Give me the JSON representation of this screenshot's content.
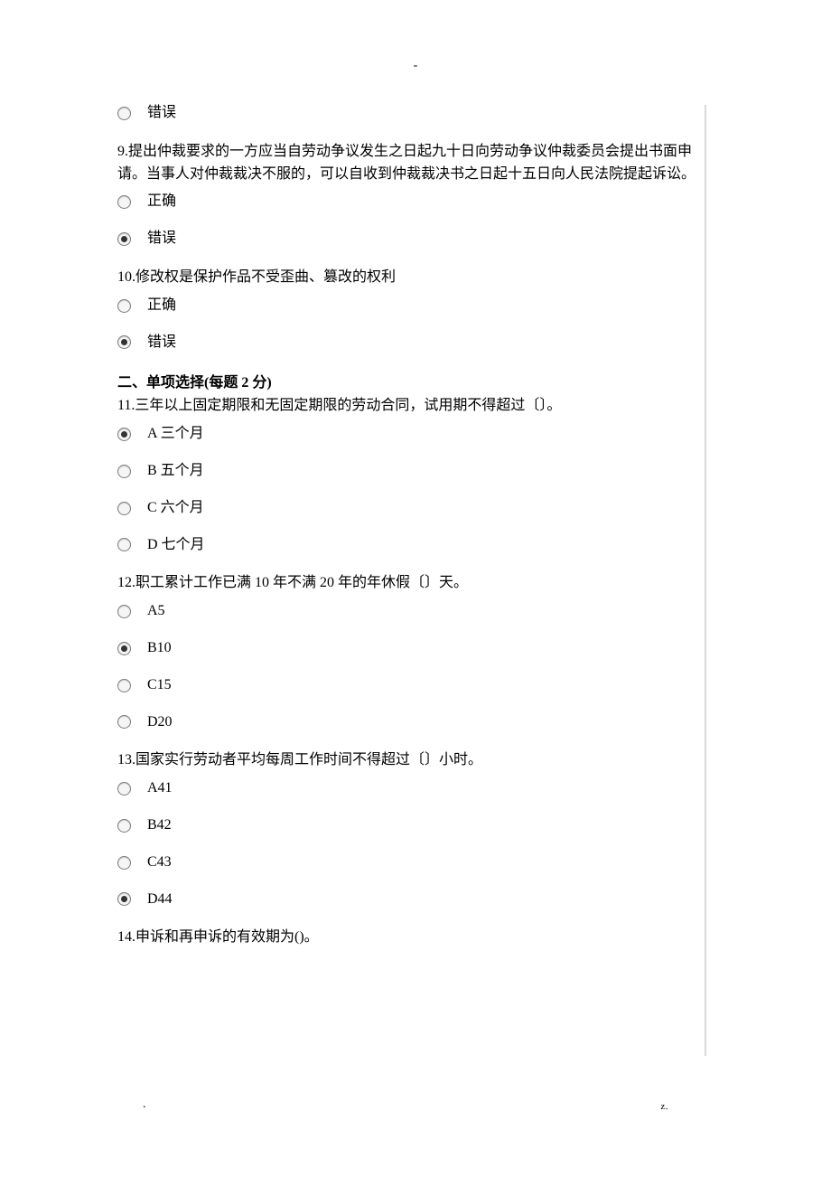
{
  "page": {
    "top_mark": "-",
    "footer_dot": ".",
    "footer_z": "z."
  },
  "q8": {
    "opt_false": "错误"
  },
  "q9": {
    "text": "9.提出仲裁要求的一方应当自劳动争议发生之日起九十日向劳动争议仲裁委员会提出书面申请。当事人对仲裁裁决不服的，可以自收到仲裁裁决书之日起十五日向人民法院提起诉讼。",
    "opt_true": "正确",
    "opt_false": "错误"
  },
  "q10": {
    "text": "10.修改权是保护作品不受歪曲、篡改的权利",
    "opt_true": "正确",
    "opt_false": "错误"
  },
  "section2": {
    "title": "二、单项选择(每题 2 分)"
  },
  "q11": {
    "text": "11.三年以上固定期限和无固定期限的劳动合同，试用期不得超过〔〕。",
    "a": "A 三个月",
    "b": "B 五个月",
    "c": "C 六个月",
    "d": "D 七个月"
  },
  "q12": {
    "text": "12.职工累计工作已满 10 年不满 20 年的年休假〔〕天。",
    "a": "A5",
    "b": "B10",
    "c": "C15",
    "d": "D20"
  },
  "q13": {
    "text": "13.国家实行劳动者平均每周工作时间不得超过〔〕小时。",
    "a": "A41",
    "b": "B42",
    "c": "C43",
    "d": "D44"
  },
  "q14": {
    "text": "14.申诉和再申诉的有效期为()。"
  }
}
